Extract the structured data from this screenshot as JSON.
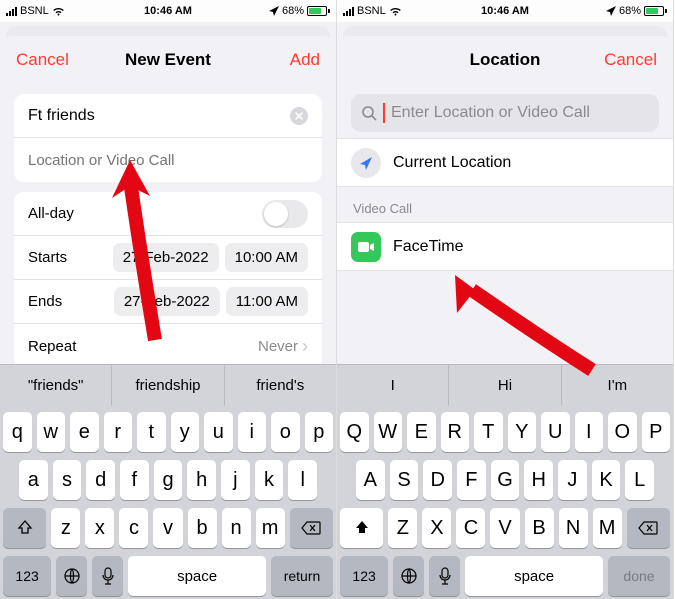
{
  "status": {
    "carrier": "BSNL",
    "time": "10:46 AM",
    "battery_pct": "68%"
  },
  "left": {
    "cancel": "Cancel",
    "title": "New Event",
    "add": "Add",
    "event_title": "Ft friends",
    "location_placeholder": "Location or Video Call",
    "allday_label": "All-day",
    "starts_label": "Starts",
    "starts_date": "27-Feb-2022",
    "starts_time": "10:00 AM",
    "ends_label": "Ends",
    "ends_date": "27-Feb-2022",
    "ends_time": "11:00 AM",
    "repeat_label": "Repeat",
    "repeat_value": "Never",
    "suggestions": [
      "\"friends\"",
      "friendship",
      "friend's"
    ],
    "keys_r1": [
      "q",
      "w",
      "e",
      "r",
      "t",
      "y",
      "u",
      "i",
      "o",
      "p"
    ],
    "keys_r2": [
      "a",
      "s",
      "d",
      "f",
      "g",
      "h",
      "j",
      "k",
      "l"
    ],
    "keys_r3": [
      "z",
      "x",
      "c",
      "v",
      "b",
      "n",
      "m"
    ],
    "key_123": "123",
    "key_space": "space",
    "key_return": "return"
  },
  "right": {
    "title": "Location",
    "cancel": "Cancel",
    "search_placeholder": "Enter Location or Video Call",
    "current_location": "Current Location",
    "section_video": "Video Call",
    "facetime": "FaceTime",
    "suggestions": [
      "I",
      "Hi",
      "I'm"
    ],
    "keys_r1": [
      "Q",
      "W",
      "E",
      "R",
      "T",
      "Y",
      "U",
      "I",
      "O",
      "P"
    ],
    "keys_r2": [
      "A",
      "S",
      "D",
      "F",
      "G",
      "H",
      "J",
      "K",
      "L"
    ],
    "keys_r3": [
      "Z",
      "X",
      "C",
      "V",
      "B",
      "N",
      "M"
    ],
    "key_123": "123",
    "key_space": "space",
    "key_done": "done"
  }
}
